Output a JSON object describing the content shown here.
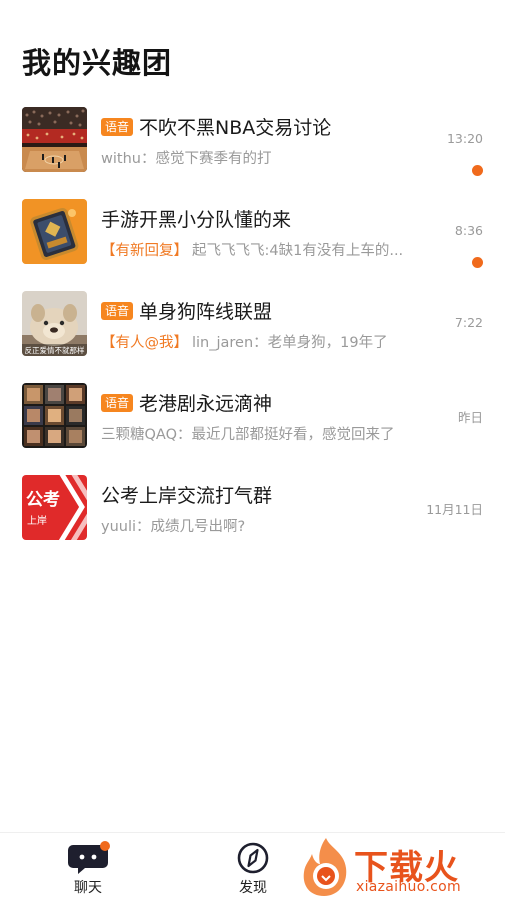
{
  "header": {
    "title": "我的兴趣团"
  },
  "groups": [
    {
      "name": "不吹不黑NBA交易讨论",
      "voice_badge": "语音",
      "time": "13:20",
      "tag": "",
      "message": "withu：感觉下赛季有的打",
      "unread": true,
      "avatar": "basketball-arena-photo"
    },
    {
      "name": "手游开黑小分队懂的来",
      "voice_badge": "",
      "time": "8:36",
      "tag": "【有新回复】",
      "message": "起飞飞飞飞:4缺1有没有上车的...",
      "unread": true,
      "avatar": "game-card-art"
    },
    {
      "name": "单身狗阵线联盟",
      "voice_badge": "语音",
      "time": "7:22",
      "tag": "【有人@我】",
      "message": "lin_jaren：老单身狗，19年了",
      "unread": false,
      "avatar": "dog-meme-photo",
      "avatar_caption": "反正爱情不就那样"
    },
    {
      "name": "老港剧永远滴神",
      "voice_badge": "语音",
      "time": "昨日",
      "tag": "",
      "message": "三颗糖QAQ：最近几部都挺好看，感觉回来了",
      "unread": false,
      "avatar": "hk-drama-collage"
    },
    {
      "name": "公考上岸交流打气群",
      "voice_badge": "",
      "time": "11月11日",
      "tag": "",
      "message": "yuuli：成绩几号出啊?",
      "unread": false,
      "avatar": "exam-logo",
      "avatar_text_main": "公考",
      "avatar_text_sub": "上岸"
    }
  ],
  "tabbar": {
    "chat_label": "聊天",
    "discover_label": "发现",
    "chat_has_badge": true
  },
  "watermark": {
    "title": "下载火",
    "subtitle": "xiazaihuo.com"
  },
  "colors": {
    "accent": "#f06a1c",
    "badge": "#f6861f",
    "tag": "#f07a24",
    "subtext": "#9a9a9a",
    "title": "#141414"
  }
}
